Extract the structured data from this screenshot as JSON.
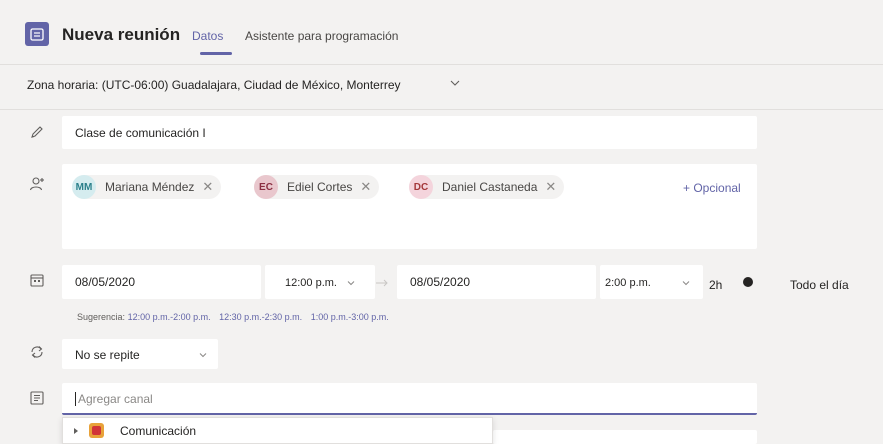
{
  "header": {
    "title": "Nueva reunión",
    "tabs": [
      {
        "label": "Datos",
        "active": true
      },
      {
        "label": "Asistente para programación",
        "active": false
      }
    ]
  },
  "timezone": {
    "label": "Zona horaria: (UTC-06:00) Guadalajara, Ciudad de México, Monterrey"
  },
  "meeting_title": {
    "value": "Clase de comunicación I"
  },
  "attendees": [
    {
      "initials": "MM",
      "name": "Mariana Méndez",
      "bg": "#d5ecef",
      "fg": "#2a7f8a"
    },
    {
      "initials": "EC",
      "name": "Ediel Cortes",
      "bg": "#e9c7cd",
      "fg": "#8b2f42"
    },
    {
      "initials": "DC",
      "name": "Daniel Castaneda",
      "bg": "#f4d4dc",
      "fg": "#a4373a"
    }
  ],
  "optional_label": "+ Opcional",
  "schedule": {
    "start_date": "08/05/2020",
    "start_time": "12:00 p.m.",
    "end_date": "08/05/2020",
    "end_time": "2:00 p.m.",
    "duration": "2h",
    "all_day_label": "Todo el día",
    "all_day": false
  },
  "suggestion": {
    "label": "Sugerencia:",
    "slots": [
      "12:00 p.m.-2:00 p.m.",
      "12:30 p.m.-2:30 p.m.",
      "1:00 p.m.-3:00 p.m."
    ]
  },
  "repeat": {
    "value": "No se repite"
  },
  "channel": {
    "placeholder": "Agregar canal"
  },
  "channel_dropdown": {
    "items": [
      {
        "label": "Comunicación"
      }
    ]
  },
  "colors": {
    "accent": "#6264a7",
    "background": "#f3f2f1",
    "field": "#ffffff"
  }
}
